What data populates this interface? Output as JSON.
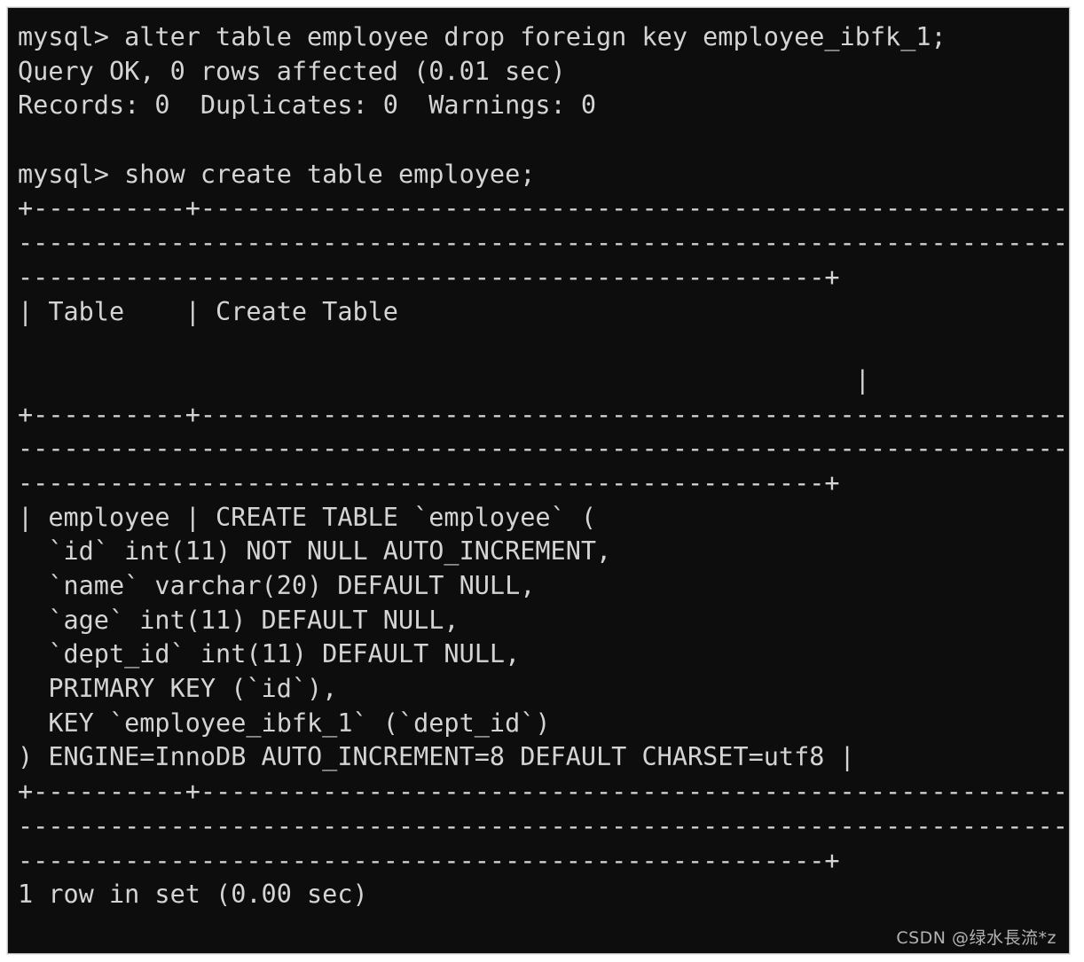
{
  "terminal": {
    "prompt": "mysql>",
    "background_color": "#0d0d0d",
    "text_color": "#d4d4d4",
    "frame_color": "#b9b9b9",
    "lines": [
      "mysql> alter table employee drop foreign key employee_ibfk_1;",
      "Query OK, 0 rows affected (0.01 sec)",
      "Records: 0  Duplicates: 0  Warnings: 0",
      "",
      "mysql> show create table employee;",
      "+----------+-------------------------------------------------------------",
      "--------------------------------------------------------------------------",
      "-----------------------------------------------------+",
      "| Table    | Create Table",
      "",
      "                                                       |",
      "+----------+-------------------------------------------------------------",
      "--------------------------------------------------------------------------",
      "-----------------------------------------------------+",
      "| employee | CREATE TABLE `employee` (",
      "  `id` int(11) NOT NULL AUTO_INCREMENT,",
      "  `name` varchar(20) DEFAULT NULL,",
      "  `age` int(11) DEFAULT NULL,",
      "  `dept_id` int(11) DEFAULT NULL,",
      "  PRIMARY KEY (`id`),",
      "  KEY `employee_ibfk_1` (`dept_id`)",
      ") ENGINE=InnoDB AUTO_INCREMENT=8 DEFAULT CHARSET=utf8 |",
      "+----------+-------------------------------------------------------------",
      "--------------------------------------------------------------------------",
      "-----------------------------------------------------+",
      "1 row in set (0.00 sec)"
    ]
  },
  "watermark": {
    "text": "CSDN @绿水長流*z"
  }
}
